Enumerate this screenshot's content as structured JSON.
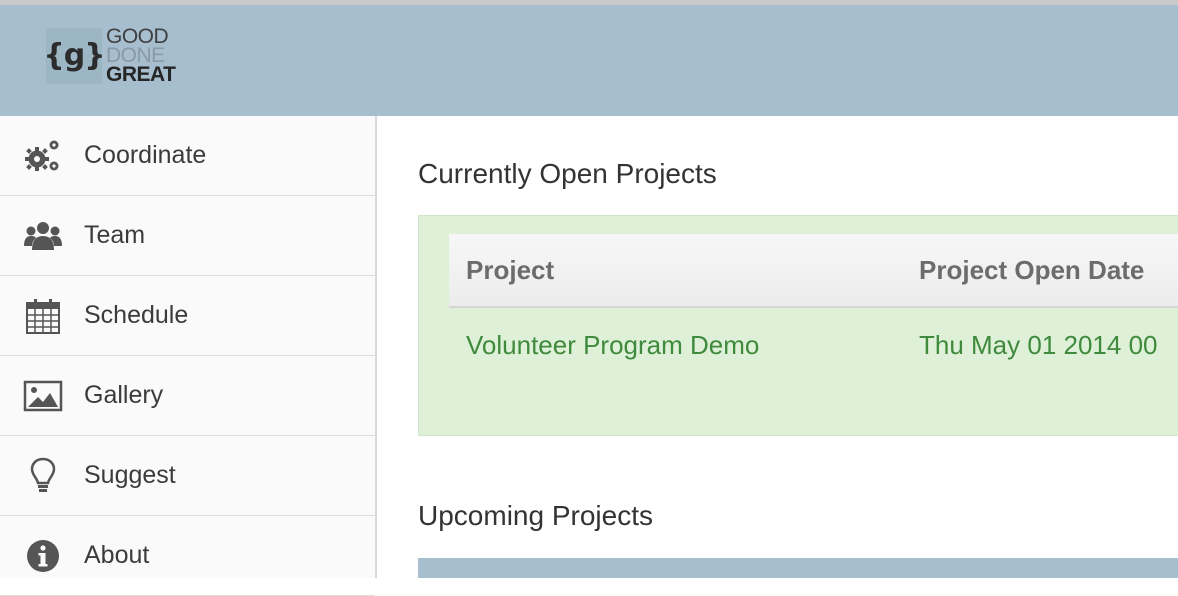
{
  "brand": {
    "logo_mark": "{g}",
    "words": [
      "GOOD",
      "DONE",
      "GREAT"
    ]
  },
  "colors": {
    "header_bg": "#a7becf",
    "open_panel_bg": "#dff0d8",
    "link_green": "#3f8a3c"
  },
  "sidebar": {
    "items": [
      {
        "label": "Coordinate",
        "icon": "gears-icon"
      },
      {
        "label": "Team",
        "icon": "users-icon"
      },
      {
        "label": "Schedule",
        "icon": "calendar-icon"
      },
      {
        "label": "Gallery",
        "icon": "image-icon"
      },
      {
        "label": "Suggest",
        "icon": "lightbulb-icon"
      },
      {
        "label": "About",
        "icon": "info-icon"
      }
    ]
  },
  "main": {
    "open_title": "Currently Open Projects",
    "open_table": {
      "headers": [
        "Project",
        "Project Open Date"
      ],
      "rows": [
        [
          "Volunteer Program Demo",
          "Thu May 01 2014 00"
        ]
      ]
    },
    "upcoming_title": "Upcoming Projects"
  }
}
